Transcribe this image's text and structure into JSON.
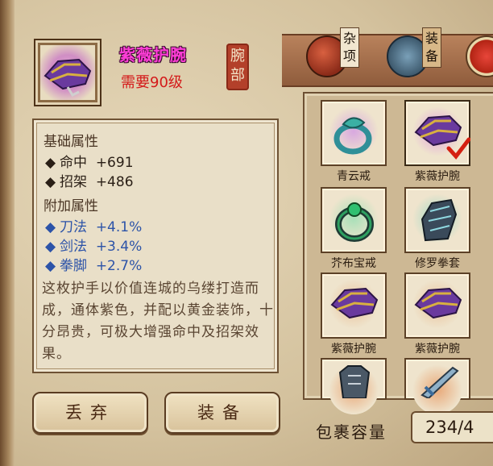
{
  "item": {
    "name": "紫薇护腕",
    "requirement": "需要90级",
    "slot_seal": [
      "腕",
      "部"
    ]
  },
  "stats": {
    "base_title": "基础属性",
    "base": [
      {
        "name": "命中",
        "value": "+691"
      },
      {
        "name": "招架",
        "value": "+486"
      }
    ],
    "extra_title": "附加属性",
    "extra": [
      {
        "name": "刀法",
        "value": "+4.1%"
      },
      {
        "name": "剑法",
        "value": "+3.4%"
      },
      {
        "name": "拳脚",
        "value": "+2.7%"
      }
    ],
    "description": "这枚护手以价值连城的乌缕打造而成，通体紫色，并配以黄金装饰，十分昂贵，可极大增强命中及招架效果。"
  },
  "buttons": {
    "discard": "丢弃",
    "equip": "装备"
  },
  "tabs": [
    {
      "label": "杂项",
      "icon": "jar-icon"
    },
    {
      "label": "装备",
      "icon": "scroll-icon"
    },
    {
      "label": "",
      "icon": "fruit-plate-icon"
    }
  ],
  "inventory": [
    {
      "name": "青云戒",
      "icon": "jade-ring-icon",
      "glow": "#c89ad8",
      "selected": false
    },
    {
      "name": "紫薇护腕",
      "icon": "purple-bracer-icon",
      "glow": "#d99ad4",
      "selected": true
    },
    {
      "name": "芥布宝戒",
      "icon": "green-ring-icon",
      "glow": "#a8d8b0",
      "selected": false
    },
    {
      "name": "修罗拳套",
      "icon": "gauntlet-icon",
      "glow": "#9ed4c0",
      "selected": false
    },
    {
      "name": "紫薇护腕",
      "icon": "purple-bracer-icon",
      "glow": "#e0b890",
      "selected": false
    },
    {
      "name": "紫薇护腕",
      "icon": "purple-bracer-icon",
      "glow": "#e0b890",
      "selected": false
    },
    {
      "name": "",
      "icon": "armor-icon",
      "glow": "#e0a070",
      "selected": false
    },
    {
      "name": "",
      "icon": "blade-icon",
      "glow": "#e0a070",
      "selected": false
    }
  ],
  "capacity": {
    "label": "包裹容量",
    "value": "234/4"
  },
  "colors": {
    "item_name": "#ff3dd8",
    "requirement": "#d41a1a",
    "extra_stat": "#2c53a8",
    "seal": "#b3402a"
  }
}
